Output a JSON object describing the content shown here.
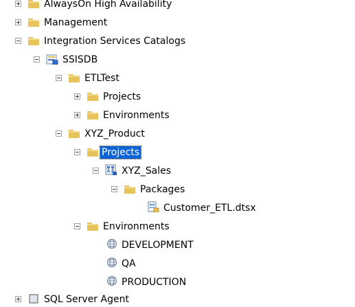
{
  "tree": {
    "alwayson": "AlwaysOn High Availability",
    "management": "Management",
    "integration": "Integration Services Catalogs",
    "ssisdb": "SSISDB",
    "etltest": "ETLTest",
    "etltest_projects": "Projects",
    "etltest_envs": "Environments",
    "xyz_product": "XYZ_Product",
    "xyz_projects": "Projects",
    "xyz_sales": "XYZ_Sales",
    "packages": "Packages",
    "package_file": "Customer_ETL.dtsx",
    "xyz_envs": "Environments",
    "env_dev": "DEVELOPMENT",
    "env_qa": "QA",
    "env_prod": "PRODUCTION",
    "bottom_partial": "SQL Server Agent"
  },
  "colors": {
    "folder": "#e8c25a",
    "selection": "#0a64d8"
  },
  "icons": {
    "folder": "folder-icon",
    "catalog": "catalog-db-icon",
    "project": "ssis-project-icon",
    "package": "package-file-icon",
    "environment": "environment-globe-icon"
  }
}
